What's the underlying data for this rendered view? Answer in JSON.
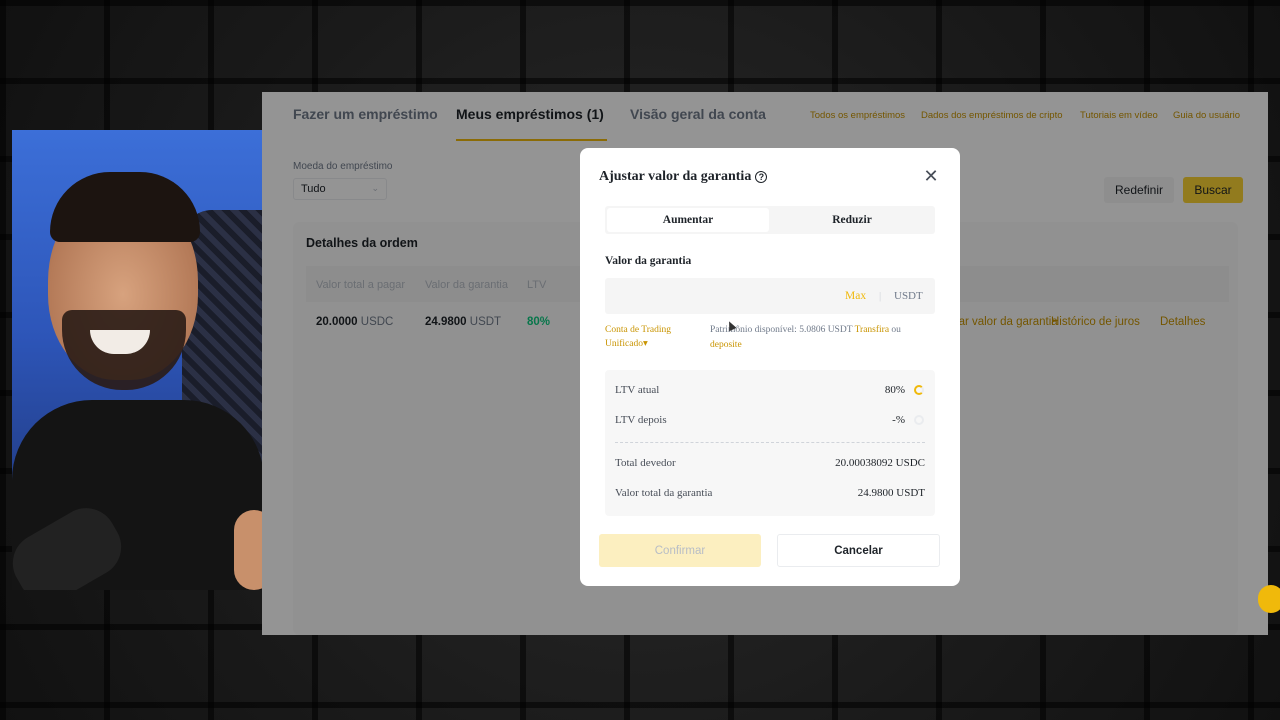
{
  "nav": {
    "tabs": [
      {
        "label": "Fazer um empréstimo"
      },
      {
        "label": "Meus empréstimos (1)"
      },
      {
        "label": "Visão geral da conta"
      }
    ],
    "links": [
      "Todos os empréstimos",
      "Dados dos empréstimos de cripto",
      "Tutoriais em vídeo",
      "Guia do usuário"
    ]
  },
  "filter": {
    "label": "Moeda do empréstimo",
    "value": "Tudo",
    "reset": "Redefinir",
    "search": "Buscar"
  },
  "order": {
    "title": "Detalhes da ordem",
    "headers": [
      "Valor total a pagar",
      "Valor da garantia",
      "LTV"
    ],
    "row": {
      "total": "20.0000",
      "total_unit": "USDC",
      "collateral": "24.9800",
      "collateral_unit": "USDT",
      "ltv": "80%",
      "actions": [
        "Ajustar valor da garantia",
        "Histórico de juros",
        "Detalhes"
      ]
    }
  },
  "modal": {
    "title": "Ajustar valor da garantia",
    "tabs": [
      "Aumentar",
      "Reduzir"
    ],
    "field_label": "Valor da garantia",
    "max": "Max",
    "separator": "|",
    "unit": "USDT",
    "account": "Conta de Trading Unificado▾",
    "available_prefix": "Patrimônio disponível: 5.0806 USDT",
    "transfer": "Transfira",
    "or": "ou",
    "deposit": "deposite",
    "summary": {
      "ltv_now_label": "LTV atual",
      "ltv_now": "80%",
      "ltv_after_label": "LTV depois",
      "ltv_after": "-%",
      "debt_label": "Total devedor",
      "debt": "20.00038092 USDC",
      "collateral_label": "Valor total da garantia",
      "collateral": "24.9800 USDT"
    },
    "confirm": "Confirmar",
    "cancel": "Cancelar"
  },
  "colors": {
    "accent": "#f0b90b",
    "link": "#c99400",
    "positive": "#0ecb81"
  }
}
